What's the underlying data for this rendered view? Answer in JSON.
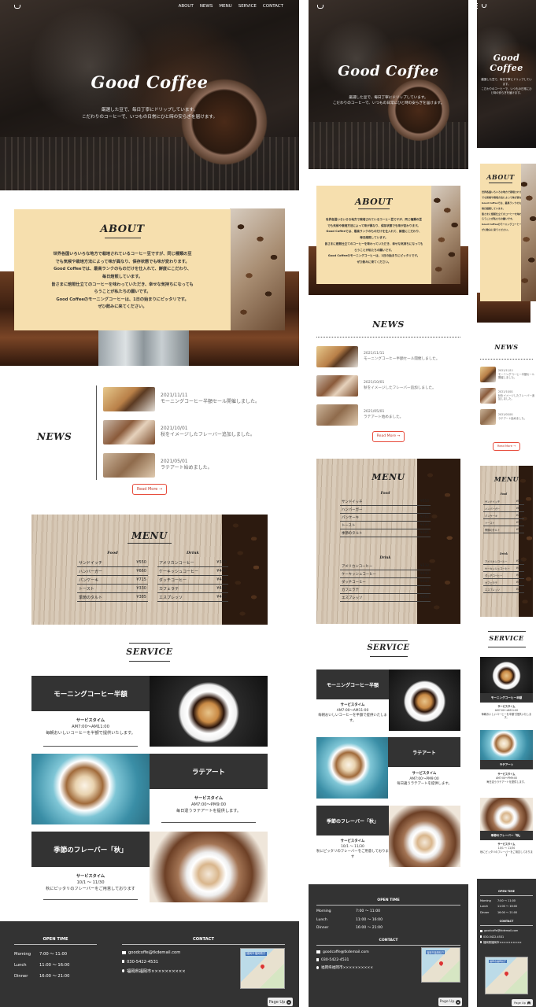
{
  "nav": {
    "items": [
      "ABOUT",
      "NEWS",
      "MENU",
      "SERVICE",
      "CONTACT"
    ]
  },
  "hero": {
    "title": "Good Coffee",
    "line1": "厳選した豆で、毎日丁寧にドリップしています。",
    "line2": "こだわりのコーヒーで、いつもの日常にひと時の安らぎを届けます。"
  },
  "about": {
    "title": "ABOUT",
    "lines": [
      "世界各国いろいろな地方で栽培されているコーヒー豆ですが、同じ種類の豆",
      "でも気候や栽培方法によって味が異なり、保存状態でも味が変わります。",
      "Good Coffeeでは、最高ランクのものだけを仕入れて、鮮度にこだわり、",
      "毎日焙煎しています。",
      "皆さまに焙煎仕立てのコーヒーを味わっていただき、幸せな気持ちになっても",
      "らうことが私たちの願いです。",
      "Good Coffeeのモーニングコーヒーは、1日の始まりにピッタリです。",
      "ぜひ飲みに来てください。"
    ]
  },
  "news": {
    "title": "NEWS",
    "items": [
      {
        "date": "2021/11/11",
        "text": "モーニングコーヒー半額セール開催しました。"
      },
      {
        "date": "2021/10/01",
        "text": "秋をイメージしたフレーバー追加しました。"
      },
      {
        "date": "2021/05/01",
        "text": "ラテアート始めました。"
      }
    ],
    "more": "Read More →"
  },
  "menu": {
    "title": "MENU",
    "food_label": "Food",
    "drink_label": "Drink",
    "food": [
      {
        "name": "サンドイッチ",
        "price": "¥550"
      },
      {
        "name": "ハンバーガー",
        "price": "¥660"
      },
      {
        "name": "パンケーキ",
        "price": "¥715"
      },
      {
        "name": "トースト",
        "price": "¥330"
      },
      {
        "name": "季節のタルト",
        "price": "¥385"
      }
    ],
    "drink": [
      {
        "name": "アメリカンコーヒー",
        "price": "¥330"
      },
      {
        "name": "ケーキッシュコーヒー",
        "price": "¥440"
      },
      {
        "name": "ダッチコーヒー",
        "price": "¥440"
      },
      {
        "name": "カフェラテ",
        "price": "¥440"
      },
      {
        "name": "エスプレッソ",
        "price": "¥460"
      }
    ]
  },
  "service": {
    "title": "SERVICE",
    "items": [
      {
        "name": "モーニングコーヒー半額",
        "label": "サービスタイム",
        "time": "AM7:00～AM11:00",
        "desc": "毎朝おいしいコーヒーを半額で提供いたします。"
      },
      {
        "name": "ラテアート",
        "label": "サービスタイム",
        "time": "AM7:00～PM9:00",
        "desc": "毎日違うラテアートを提供します。"
      },
      {
        "name": "季節のフレーバー「秋」",
        "label": "サービスタイム",
        "time": "10/1 ～ 11/30",
        "desc": "秋にピッタリのフレーバーをご用意しております"
      }
    ],
    "mobile_names": [
      "モーニングコーヒー半額",
      "ラテアート",
      "季節のフレーバー「秋」"
    ],
    "narrow_desc": [
      "毎朝おいしいコーヒーを半額で提供いたします。",
      "毎日違うラテアートを提供します。",
      "秋にピッタリのフレーバーをご用意しております"
    ]
  },
  "hours": {
    "title": "OPEN TIME",
    "rows": [
      {
        "label": "Morning",
        "time": "7:00 ～ 11:00"
      },
      {
        "label": "Lunch",
        "time": "11:00 ～ 16:00"
      },
      {
        "label": "Dinner",
        "time": "16:00 ～ 21:00"
      }
    ]
  },
  "contact": {
    "title": "CONTACT",
    "email": "goodcoffe@tkdemail.com",
    "tel": "030-5422-4531",
    "address": "福岡県福岡市××××××××××",
    "map_label": "福岡市福岡県庁"
  },
  "pageup": "Page Up",
  "colors": {
    "dark": "#333333",
    "cream": "#f6dfae",
    "accent": "#e74c3c"
  }
}
